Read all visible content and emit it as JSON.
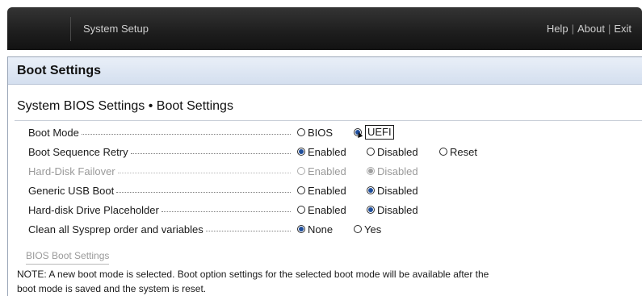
{
  "header": {
    "title": "System Setup",
    "links": [
      "Help",
      "About",
      "Exit"
    ],
    "separator": "|"
  },
  "page": {
    "banner_title": "Boot Settings",
    "section_title": "System BIOS Settings • Boot Settings"
  },
  "settings": [
    {
      "label": "Boot Mode",
      "enabled": true,
      "options": [
        {
          "label": "BIOS",
          "selected": false
        },
        {
          "label": "UEFI",
          "selected": true,
          "focused": true
        }
      ]
    },
    {
      "label": "Boot Sequence Retry",
      "enabled": true,
      "options": [
        {
          "label": "Enabled",
          "selected": true
        },
        {
          "label": "Disabled",
          "selected": false
        },
        {
          "label": "Reset",
          "selected": false
        }
      ]
    },
    {
      "label": "Hard-Disk Failover",
      "enabled": false,
      "options": [
        {
          "label": "Enabled",
          "selected": false
        },
        {
          "label": "Disabled",
          "selected": true
        }
      ]
    },
    {
      "label": "Generic USB Boot",
      "enabled": true,
      "options": [
        {
          "label": "Enabled",
          "selected": false
        },
        {
          "label": "Disabled",
          "selected": true
        }
      ]
    },
    {
      "label": "Hard-disk Drive Placeholder",
      "enabled": true,
      "options": [
        {
          "label": "Enabled",
          "selected": false
        },
        {
          "label": "Disabled",
          "selected": true
        }
      ]
    },
    {
      "label": "Clean all Sysprep order and variables",
      "enabled": true,
      "options": [
        {
          "label": "None",
          "selected": true
        },
        {
          "label": "Yes",
          "selected": false
        }
      ]
    }
  ],
  "bios_boot_settings_link": "BIOS Boot Settings",
  "note": "NOTE: A new boot mode is selected. Boot option settings for the selected boot mode will be available after the boot mode is saved and the system is reset.",
  "colors": {
    "header_background": "#1f1f1f",
    "banner_background": "#d4dfef",
    "radio_selected": "#1f4e9c",
    "disabled_text": "#9a9a9a"
  }
}
